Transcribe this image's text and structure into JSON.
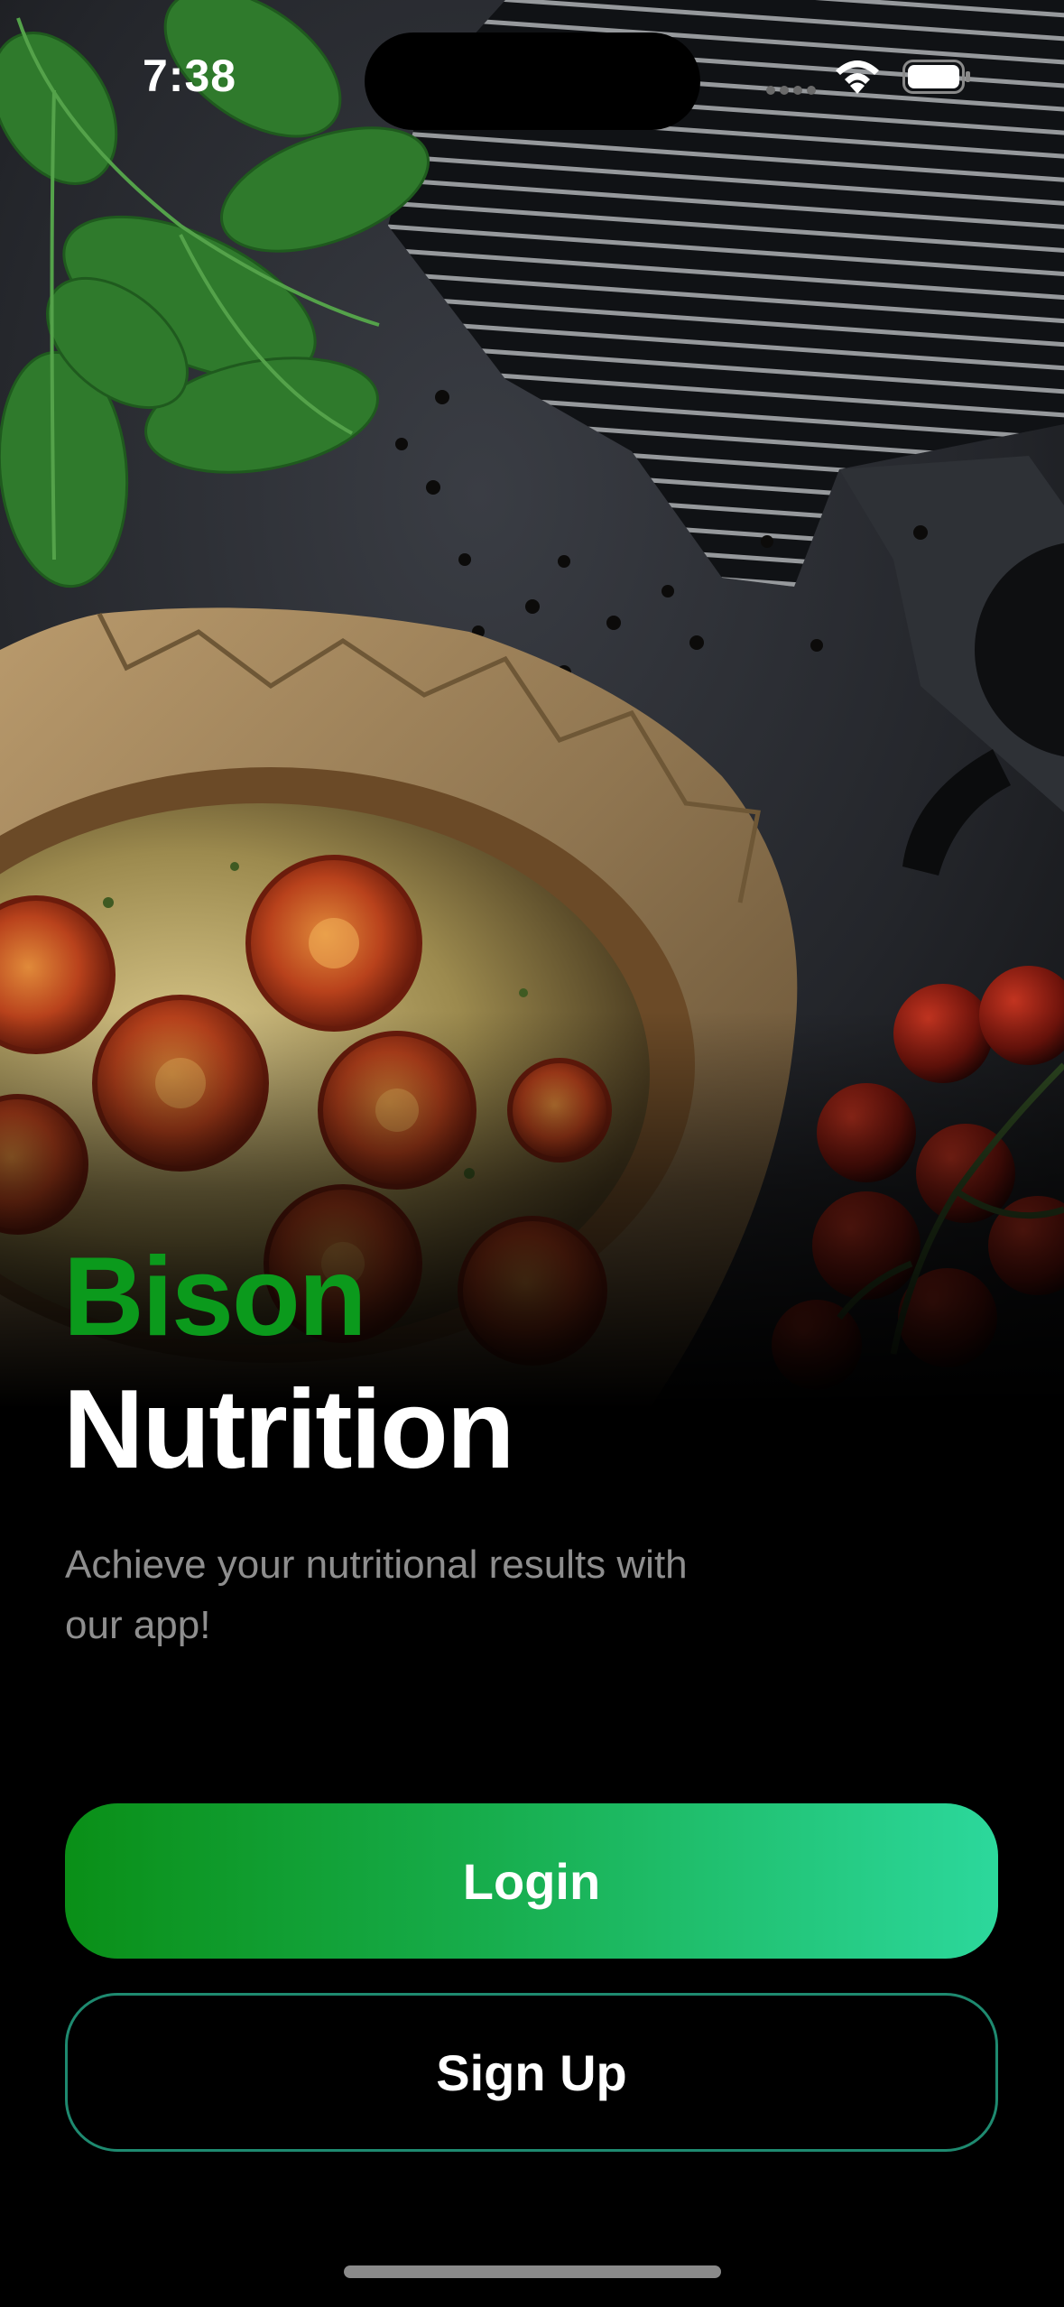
{
  "status_bar": {
    "time": "7:38",
    "wifi_icon": "wifi-icon",
    "battery_icon": "battery-full-icon"
  },
  "hero": {
    "image": "food-photo-quiche-tomatoes-spinach"
  },
  "brand": {
    "line1": "Bison",
    "line2": "Nutrition",
    "accent_color": "#0b9a1c"
  },
  "tagline": "Achieve your nutritional results with our app!",
  "buttons": {
    "login_label": "Login",
    "signup_label": "Sign Up",
    "login_gradient": [
      "#0a8f17",
      "#2cd89c"
    ],
    "signup_border_color": "#1e8a70"
  }
}
